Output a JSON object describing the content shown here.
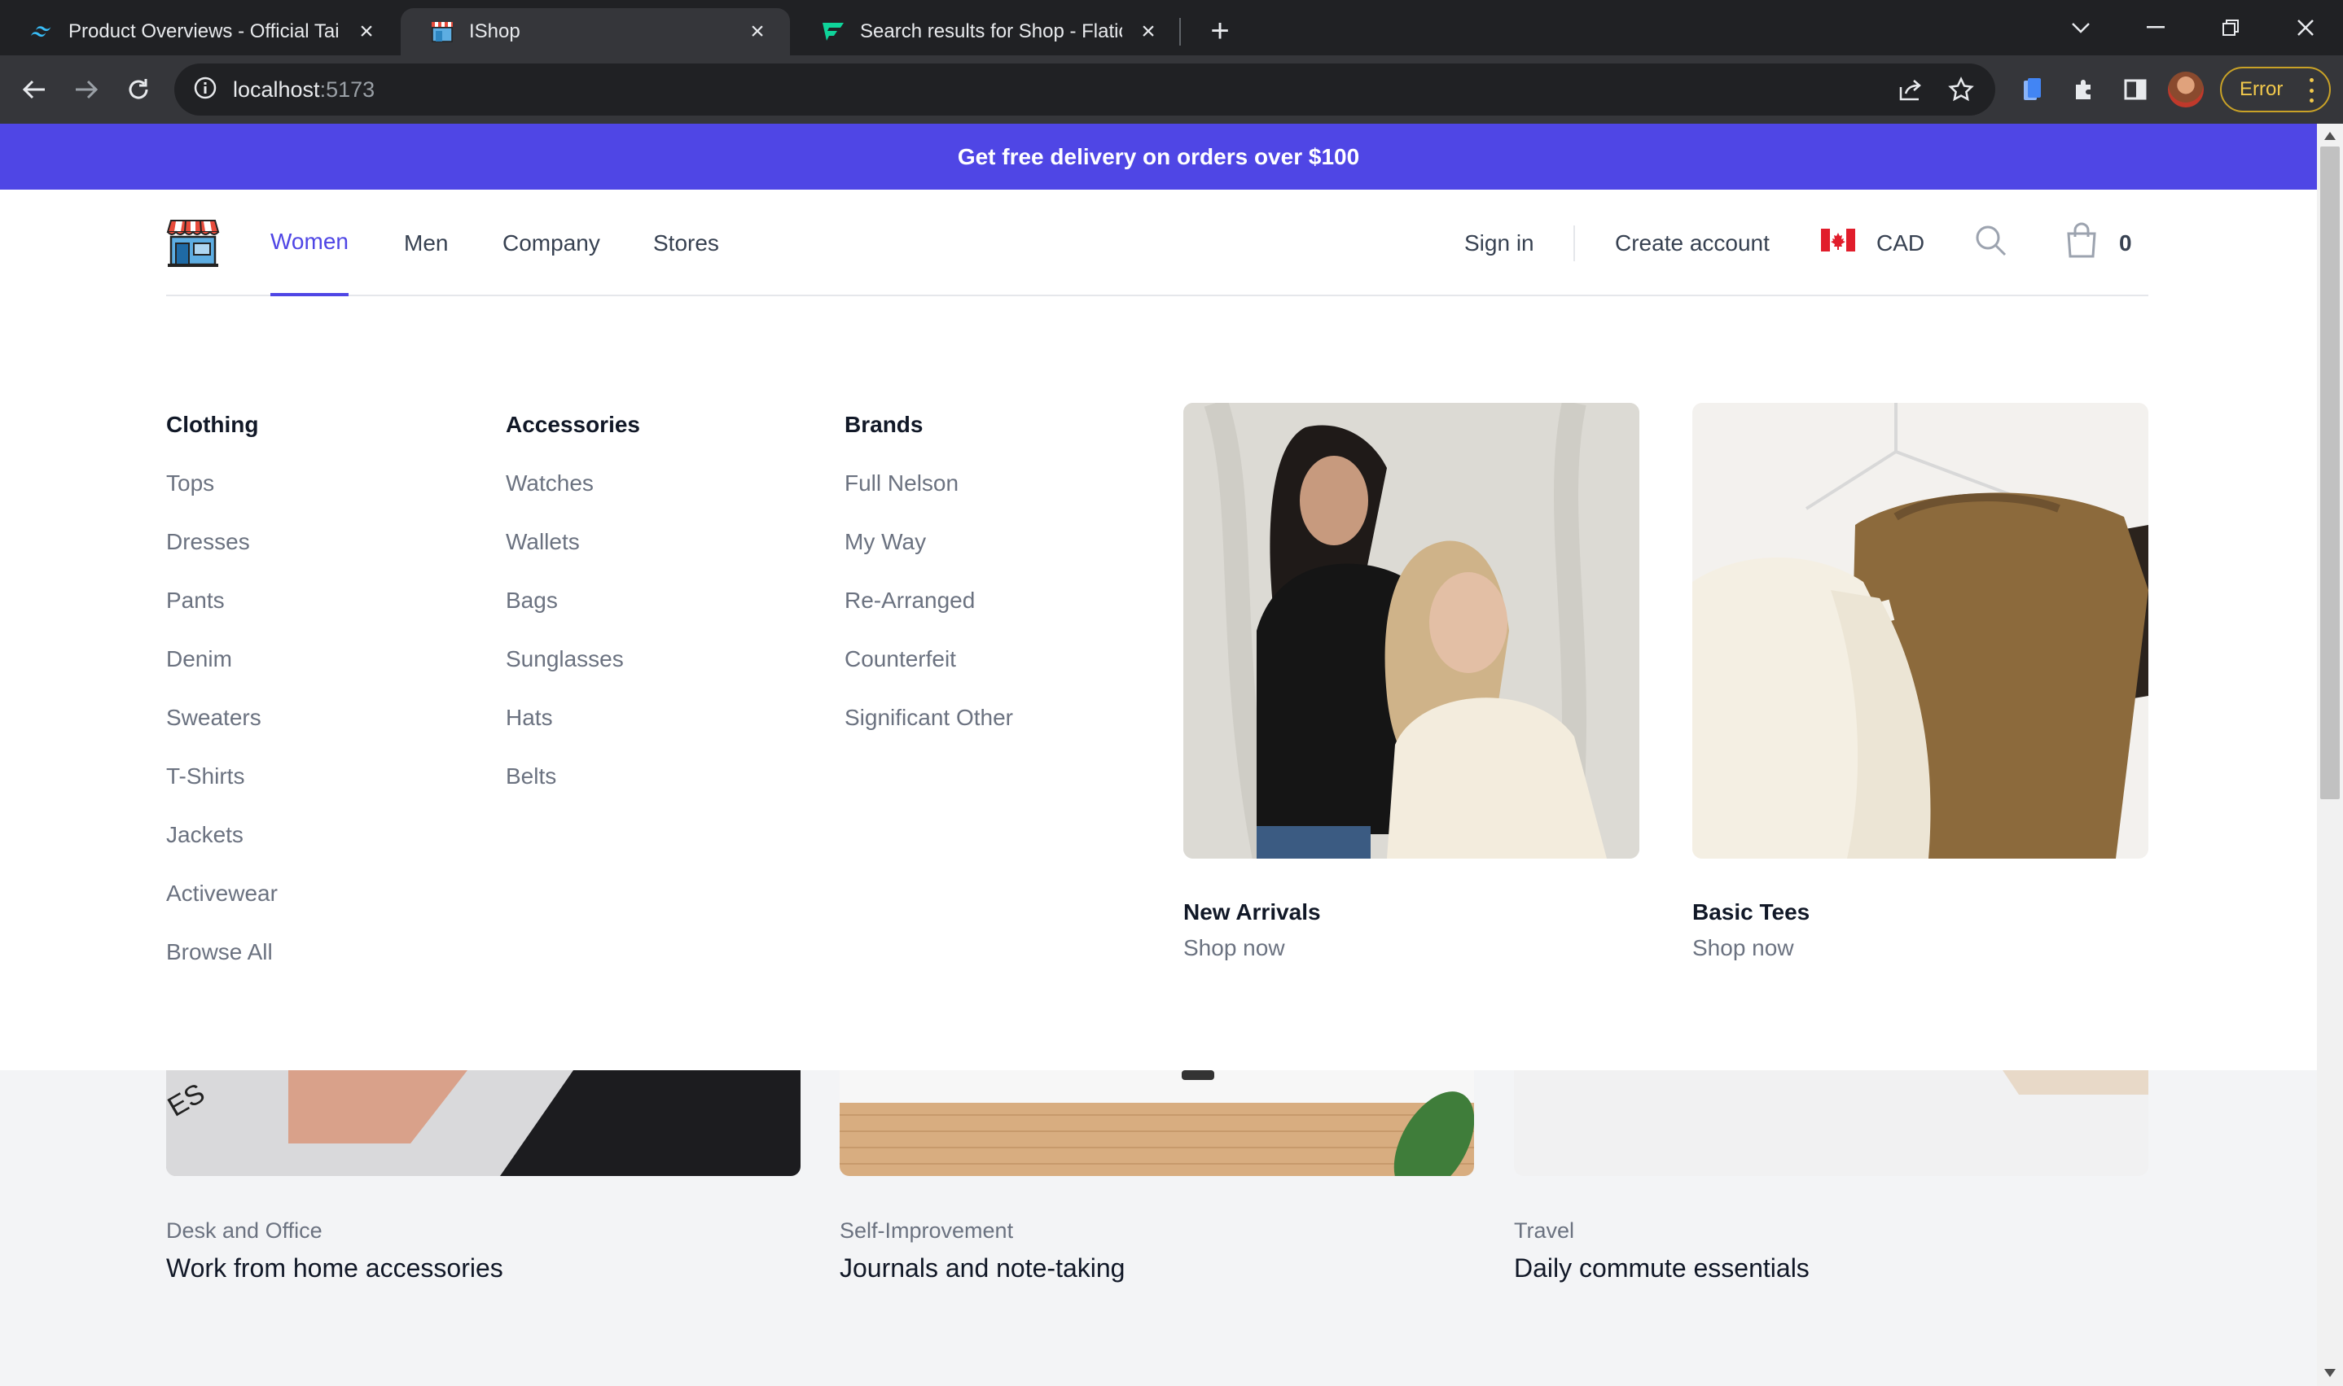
{
  "browser": {
    "tabs": [
      {
        "title": "Product Overviews - Official Tailw",
        "icon": "tailwind-icon",
        "active": false
      },
      {
        "title": "IShop",
        "icon": "shop-icon",
        "active": true
      },
      {
        "title": "Search results for Shop - Flaticon",
        "icon": "flaticon-icon",
        "active": false
      }
    ],
    "url_host": "localhost",
    "url_port": ":5173",
    "profile_status": "Error"
  },
  "promo": {
    "text": "Get free delivery on orders over $100"
  },
  "nav": {
    "links": [
      "Women",
      "Men",
      "Company",
      "Stores"
    ],
    "active": "Women",
    "sign_in": "Sign in",
    "create_account": "Create account",
    "currency": "CAD",
    "cart_count": "0"
  },
  "mega_menu": {
    "columns": [
      {
        "title": "Clothing",
        "items": [
          "Tops",
          "Dresses",
          "Pants",
          "Denim",
          "Sweaters",
          "T-Shirts",
          "Jackets",
          "Activewear",
          "Browse All"
        ]
      },
      {
        "title": "Accessories",
        "items": [
          "Watches",
          "Wallets",
          "Bags",
          "Sunglasses",
          "Hats",
          "Belts"
        ]
      },
      {
        "title": "Brands",
        "items": [
          "Full Nelson",
          "My Way",
          "Re-Arranged",
          "Counterfeit",
          "Significant Other"
        ]
      }
    ],
    "featured": [
      {
        "name": "New Arrivals",
        "cta": "Shop now"
      },
      {
        "name": "Basic Tees",
        "cta": "Shop now"
      }
    ]
  },
  "collections": [
    {
      "subtitle": "Desk and Office",
      "title": "Work from home accessories"
    },
    {
      "subtitle": "Self-Improvement",
      "title": "Journals and note-taking"
    },
    {
      "subtitle": "Travel",
      "title": "Daily commute essentials"
    }
  ],
  "colors": {
    "accent": "#4f46e5",
    "text": "#111827",
    "muted": "#6b7280",
    "chrome_dark": "#202124",
    "chrome_mid": "#35363a"
  }
}
